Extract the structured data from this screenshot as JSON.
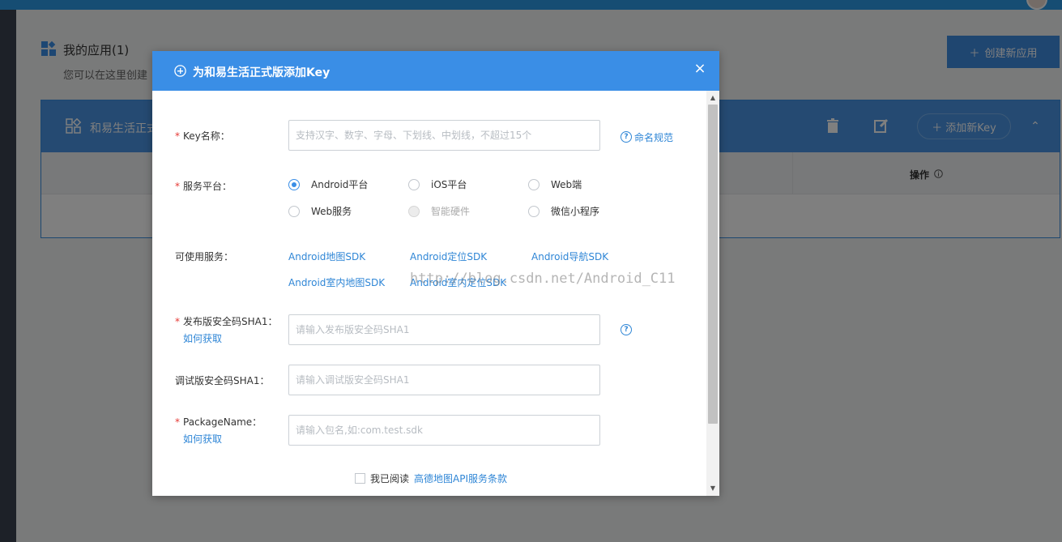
{
  "background": {
    "apps_title": "我的应用(1)",
    "apps_subtitle": "您可以在这里创建",
    "create_app_label": "创建新应用",
    "app_card": {
      "name": "和易生活正式",
      "add_key_label": "添加新Key",
      "column_operation": "操作"
    }
  },
  "modal": {
    "title": "为和易生活正式版添加Key",
    "close_glyph": "×",
    "key_name": {
      "label": "Key名称：",
      "placeholder": "支持汉字、数字、字母、下划线、中划线，不超过15个",
      "help_label": "命名规范"
    },
    "platform": {
      "label": "服务平台：",
      "options": [
        {
          "label": "Android平台",
          "selected": true,
          "disabled": false
        },
        {
          "label": "iOS平台",
          "selected": false,
          "disabled": false
        },
        {
          "label": "Web端",
          "selected": false,
          "disabled": false
        },
        {
          "label": "Web服务",
          "selected": false,
          "disabled": false
        },
        {
          "label": "智能硬件",
          "selected": false,
          "disabled": true
        },
        {
          "label": "微信小程序",
          "selected": false,
          "disabled": false
        }
      ]
    },
    "services": {
      "label": "可使用服务：",
      "items": [
        "Android地图SDK",
        "Android定位SDK",
        "Android导航SDK",
        "Android室内地图SDK",
        "Android室内定位SDK"
      ]
    },
    "release_sha1": {
      "label": "发布版安全码SHA1：",
      "how_to": "如何获取",
      "placeholder": "请输入发布版安全码SHA1"
    },
    "debug_sha1": {
      "label": "调试版安全码SHA1：",
      "placeholder": "请输入调试版安全码SHA1"
    },
    "package_name": {
      "label": "PackageName：",
      "how_to": "如何获取",
      "placeholder": "请输入包名,如:com.test.sdk"
    },
    "agreement": {
      "prefix": "我已阅读",
      "link": "高德地图API服务条款"
    },
    "watermark": "http://blog.csdn.net/Android_C11"
  },
  "colors": {
    "primary": "#3a8ee6",
    "link": "#2f86d6",
    "required": "#e53935"
  }
}
